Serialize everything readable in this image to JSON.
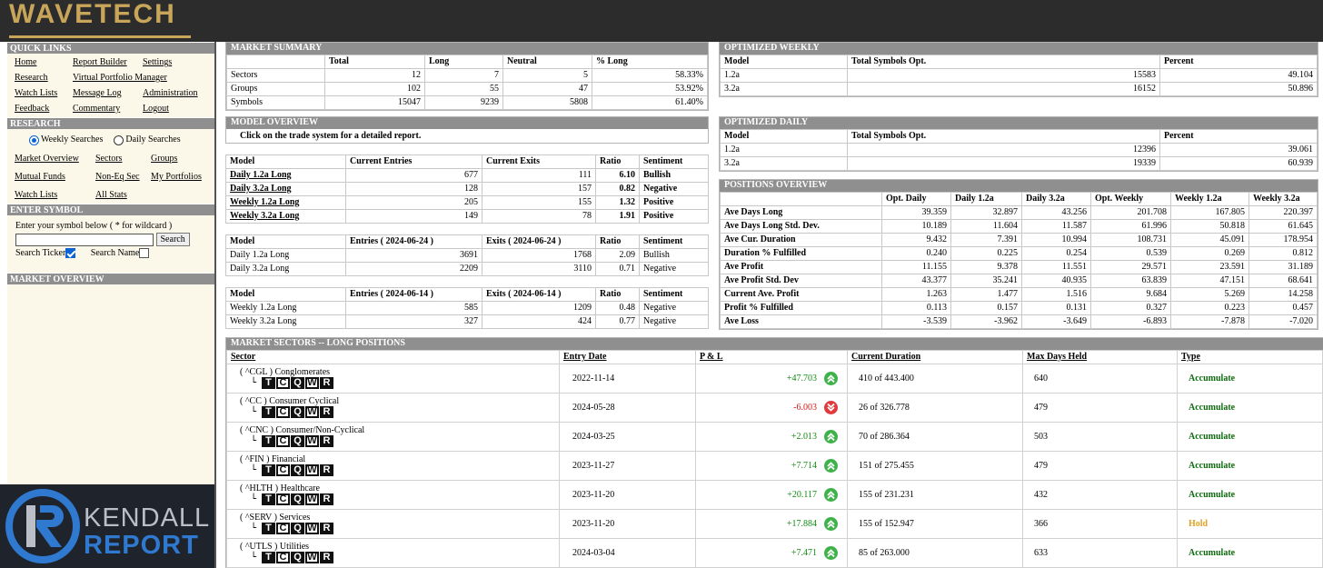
{
  "brand": {
    "logo": "WAVETECH",
    "footer_logo_top": "KENDALL",
    "footer_logo_bottom": "REPORT"
  },
  "sidebar": {
    "quick_links_title": "QUICK LINKS",
    "quick_links": [
      "Home",
      "Report Builder",
      "Settings",
      "Research",
      "Virtual Portfolio Manager",
      "",
      "Watch Lists",
      "Message Log",
      "Administration",
      "Feedback",
      "Commentary",
      "Logout"
    ],
    "research_title": "RESEARCH",
    "radio_weekly": "Weekly Searches",
    "radio_daily": "Daily Searches",
    "research_links": [
      "Market Overview",
      "Sectors",
      "Groups",
      "Mutual Funds",
      "Non-Eq Sec",
      "My Portfolios",
      "Watch Lists",
      "All Stats",
      ""
    ],
    "enter_symbol_title": "ENTER SYMBOL",
    "enter_symbol_prompt": "Enter your symbol below ( * for wildcard )",
    "search_button": "Search",
    "search_ticker": "Search Ticker",
    "search_name": "Search Name",
    "market_overview_title": "MARKET OVERVIEW"
  },
  "market_summary": {
    "title": "MARKET SUMMARY",
    "headers": [
      "",
      "Total",
      "Long",
      "Neutral",
      "% Long"
    ],
    "rows": [
      [
        "Sectors",
        "12",
        "7",
        "5",
        "58.33%"
      ],
      [
        "Groups",
        "102",
        "55",
        "47",
        "53.92%"
      ],
      [
        "Symbols",
        "15047",
        "9239",
        "5808",
        "61.40%"
      ]
    ]
  },
  "optimized_weekly": {
    "title": "OPTIMIZED WEEKLY",
    "headers": [
      "Model",
      "Total Symbols Opt.",
      "Percent"
    ],
    "rows": [
      [
        "1.2a",
        "15583",
        "49.104"
      ],
      [
        "3.2a",
        "16152",
        "50.896"
      ]
    ]
  },
  "optimized_daily": {
    "title": "OPTIMIZED DAILY",
    "headers": [
      "Model",
      "Total Symbols Opt.",
      "Percent"
    ],
    "rows": [
      [
        "1.2a",
        "12396",
        "39.061"
      ],
      [
        "3.2a",
        "19339",
        "60.939"
      ]
    ]
  },
  "model_overview": {
    "title": "MODEL OVERVIEW",
    "note": "Click on the trade system for a detailed report.",
    "t1_headers": [
      "Model",
      "Current Entries",
      "Current Exits",
      "Ratio",
      "Sentiment"
    ],
    "t1_rows": [
      [
        "Daily 1.2a Long",
        "677",
        "111",
        "6.10",
        "Bullish"
      ],
      [
        "Daily 3.2a Long",
        "128",
        "157",
        "0.82",
        "Negative"
      ],
      [
        "Weekly 1.2a Long",
        "205",
        "155",
        "1.32",
        "Positive"
      ],
      [
        "Weekly 3.2a Long",
        "149",
        "78",
        "1.91",
        "Positive"
      ]
    ],
    "t2_headers": [
      "Model",
      "Entries ( 2024-06-24 )",
      "Exits ( 2024-06-24 )",
      "Ratio",
      "Sentiment"
    ],
    "t2_rows": [
      [
        "Daily 1.2a Long",
        "3691",
        "1768",
        "2.09",
        "Bullish"
      ],
      [
        "Daily 3.2a Long",
        "2209",
        "3110",
        "0.71",
        "Negative"
      ]
    ],
    "t3_headers": [
      "Model",
      "Entries ( 2024-06-14 )",
      "Exits ( 2024-06-14 )",
      "Ratio",
      "Sentiment"
    ],
    "t3_rows": [
      [
        "Weekly 1.2a Long",
        "585",
        "1209",
        "0.48",
        "Negative"
      ],
      [
        "Weekly 3.2a Long",
        "327",
        "424",
        "0.77",
        "Negative"
      ]
    ]
  },
  "positions_overview": {
    "title": "POSITIONS OVERVIEW",
    "headers": [
      "",
      "Opt. Daily",
      "Daily 1.2a",
      "Daily 3.2a",
      "Opt. Weekly",
      "Weekly 1.2a",
      "Weekly 3.2a"
    ],
    "rows": [
      [
        "Ave Days Long",
        "39.359",
        "32.897",
        "43.256",
        "201.708",
        "167.805",
        "220.397"
      ],
      [
        "Ave Days Long Std. Dev.",
        "10.189",
        "11.604",
        "11.587",
        "61.996",
        "50.818",
        "61.645"
      ],
      [
        "Ave Cur. Duration",
        "9.432",
        "7.391",
        "10.994",
        "108.731",
        "45.091",
        "178.954"
      ],
      [
        "Duration % Fulfilled",
        "0.240",
        "0.225",
        "0.254",
        "0.539",
        "0.269",
        "0.812"
      ],
      [
        "Ave Profit",
        "11.155",
        "9.378",
        "11.551",
        "29.571",
        "23.591",
        "31.189"
      ],
      [
        "Ave Profit Std. Dev",
        "43.377",
        "35.241",
        "40.935",
        "63.839",
        "47.151",
        "68.641"
      ],
      [
        "Current Ave. Profit",
        "1.263",
        "1.477",
        "1.516",
        "9.684",
        "5.269",
        "14.258"
      ],
      [
        "Profit % Fulfilled",
        "0.113",
        "0.157",
        "0.131",
        "0.327",
        "0.223",
        "0.457"
      ],
      [
        "Ave Loss",
        "-3.539",
        "-3.962",
        "-3.649",
        "-6.893",
        "-7.878",
        "-7.020"
      ]
    ]
  },
  "market_sectors": {
    "title": "MARKET SECTORS -- LONG POSITIONS",
    "headers": [
      "Sector",
      "Entry Date",
      "P & L",
      "Current Duration",
      "Max Days Held",
      "Type"
    ],
    "tcq_letters": [
      "T",
      "C",
      "Q",
      "W",
      "R"
    ],
    "rows": [
      {
        "name": "( ^CGL ) Conglomerates",
        "date": "2022-11-14",
        "pl": "+47.703",
        "dir": "up",
        "dur": "410 of 443.400",
        "max": "640",
        "type": "Accumulate"
      },
      {
        "name": "( ^CC ) Consumer Cyclical",
        "date": "2024-05-28",
        "pl": "-6.003",
        "dir": "down",
        "dur": "26 of 326.778",
        "max": "479",
        "type": "Accumulate"
      },
      {
        "name": "( ^CNC ) Consumer/Non-Cyclical",
        "date": "2024-03-25",
        "pl": "+2.013",
        "dir": "up",
        "dur": "70 of 286.364",
        "max": "503",
        "type": "Accumulate"
      },
      {
        "name": "( ^FIN ) Financial",
        "date": "2023-11-27",
        "pl": "+7.714",
        "dir": "up",
        "dur": "151 of 275.455",
        "max": "479",
        "type": "Accumulate"
      },
      {
        "name": "( ^HLTH ) Healthcare",
        "date": "2023-11-20",
        "pl": "+20.117",
        "dir": "up",
        "dur": "155 of 231.231",
        "max": "432",
        "type": "Accumulate"
      },
      {
        "name": "( ^SERV ) Services",
        "date": "2023-11-20",
        "pl": "+17.884",
        "dir": "up",
        "dur": "155 of 152.947",
        "max": "366",
        "type": "Hold"
      },
      {
        "name": "( ^UTLS ) Utilities",
        "date": "2024-03-04",
        "pl": "+7.471",
        "dir": "up",
        "dur": "85 of 263.000",
        "max": "633",
        "type": "Accumulate"
      }
    ]
  }
}
